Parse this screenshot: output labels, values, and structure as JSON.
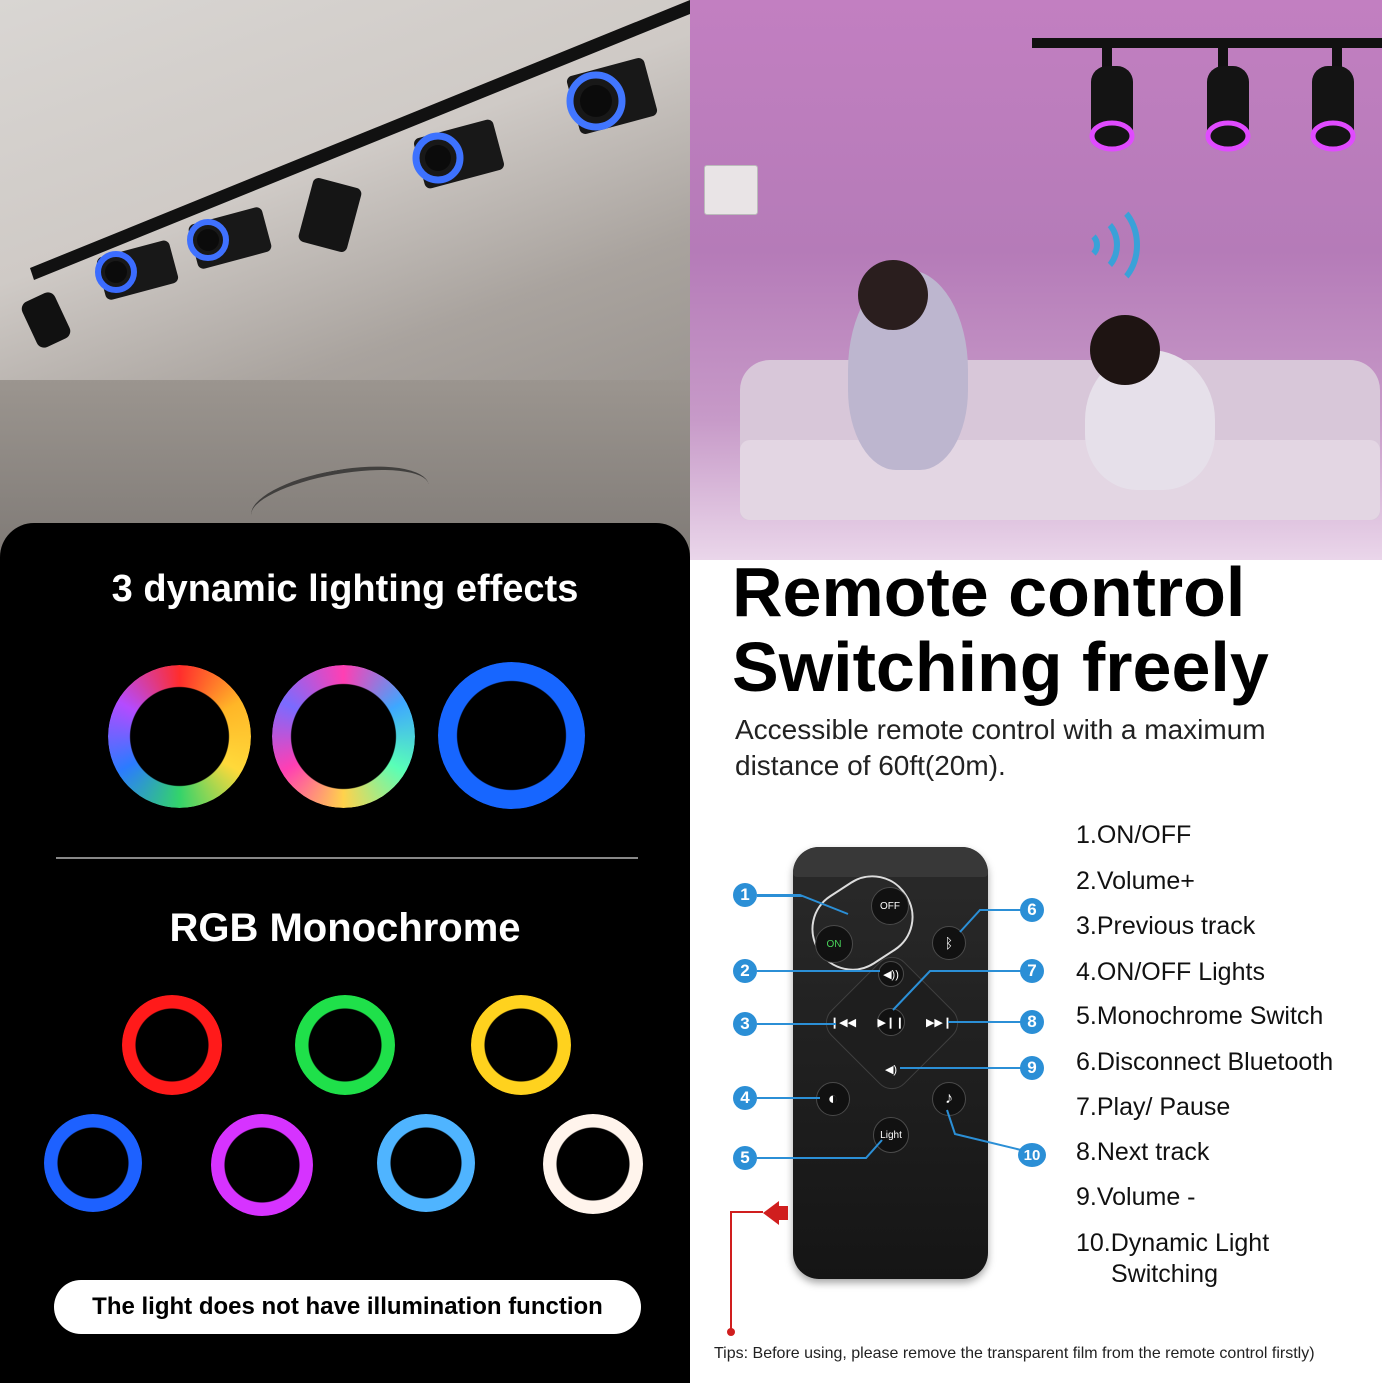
{
  "effects_panel": {
    "heading_dynamic": "3 dynamic lighting effects",
    "heading_mono": "RGB Monochrome",
    "notice": "The light does not have illumination function"
  },
  "promo": {
    "headline_line1": "Remote control",
    "headline_line2": "Switching freely",
    "subtext": "Accessible remote control with a maximum distance of 60ft(20m)."
  },
  "remote": {
    "off_label": "OFF",
    "on_label": "ON",
    "light_label": "Light",
    "callouts": [
      "1",
      "2",
      "3",
      "4",
      "5",
      "6",
      "7",
      "8",
      "9",
      "10"
    ]
  },
  "legend": [
    "1.ON/OFF",
    "2.Volume+",
    "3.Previous track",
    "4.ON/OFF Lights",
    "5.Monochrome Switch",
    "6.Disconnect Bluetooth",
    "7.Play/ Pause",
    "8.Next track",
    "9.Volume -",
    "10.Dynamic Light",
    "Switching"
  ],
  "tips": "Tips: Before using, please remove the transparent film from the remote control firstly)",
  "colors": {
    "callout_blue": "#2b8fd6",
    "arrow_red": "#d01e1e",
    "panel_black": "#000000"
  }
}
